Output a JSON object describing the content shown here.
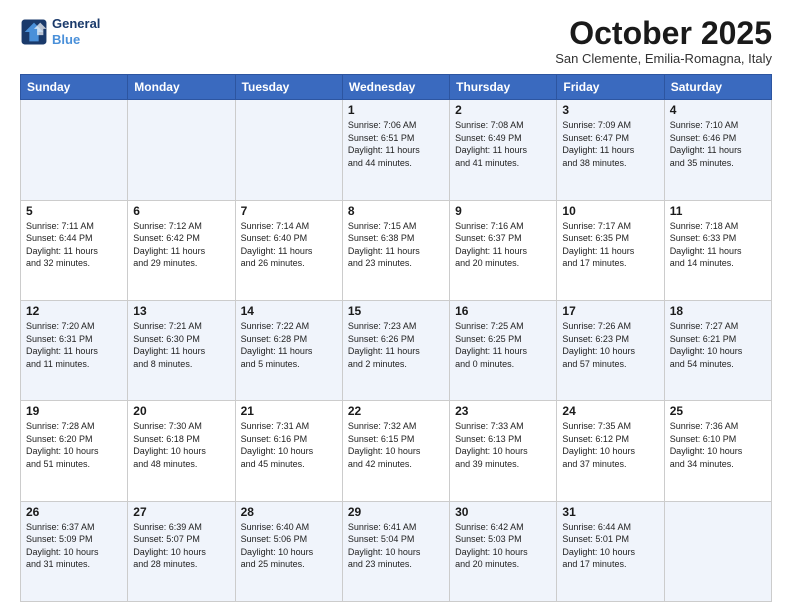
{
  "header": {
    "logo_line1": "General",
    "logo_line2": "Blue",
    "month": "October 2025",
    "location": "San Clemente, Emilia-Romagna, Italy"
  },
  "days_of_week": [
    "Sunday",
    "Monday",
    "Tuesday",
    "Wednesday",
    "Thursday",
    "Friday",
    "Saturday"
  ],
  "weeks": [
    [
      {
        "day": "",
        "info": ""
      },
      {
        "day": "",
        "info": ""
      },
      {
        "day": "",
        "info": ""
      },
      {
        "day": "1",
        "info": "Sunrise: 7:06 AM\nSunset: 6:51 PM\nDaylight: 11 hours\nand 44 minutes."
      },
      {
        "day": "2",
        "info": "Sunrise: 7:08 AM\nSunset: 6:49 PM\nDaylight: 11 hours\nand 41 minutes."
      },
      {
        "day": "3",
        "info": "Sunrise: 7:09 AM\nSunset: 6:47 PM\nDaylight: 11 hours\nand 38 minutes."
      },
      {
        "day": "4",
        "info": "Sunrise: 7:10 AM\nSunset: 6:46 PM\nDaylight: 11 hours\nand 35 minutes."
      }
    ],
    [
      {
        "day": "5",
        "info": "Sunrise: 7:11 AM\nSunset: 6:44 PM\nDaylight: 11 hours\nand 32 minutes."
      },
      {
        "day": "6",
        "info": "Sunrise: 7:12 AM\nSunset: 6:42 PM\nDaylight: 11 hours\nand 29 minutes."
      },
      {
        "day": "7",
        "info": "Sunrise: 7:14 AM\nSunset: 6:40 PM\nDaylight: 11 hours\nand 26 minutes."
      },
      {
        "day": "8",
        "info": "Sunrise: 7:15 AM\nSunset: 6:38 PM\nDaylight: 11 hours\nand 23 minutes."
      },
      {
        "day": "9",
        "info": "Sunrise: 7:16 AM\nSunset: 6:37 PM\nDaylight: 11 hours\nand 20 minutes."
      },
      {
        "day": "10",
        "info": "Sunrise: 7:17 AM\nSunset: 6:35 PM\nDaylight: 11 hours\nand 17 minutes."
      },
      {
        "day": "11",
        "info": "Sunrise: 7:18 AM\nSunset: 6:33 PM\nDaylight: 11 hours\nand 14 minutes."
      }
    ],
    [
      {
        "day": "12",
        "info": "Sunrise: 7:20 AM\nSunset: 6:31 PM\nDaylight: 11 hours\nand 11 minutes."
      },
      {
        "day": "13",
        "info": "Sunrise: 7:21 AM\nSunset: 6:30 PM\nDaylight: 11 hours\nand 8 minutes."
      },
      {
        "day": "14",
        "info": "Sunrise: 7:22 AM\nSunset: 6:28 PM\nDaylight: 11 hours\nand 5 minutes."
      },
      {
        "day": "15",
        "info": "Sunrise: 7:23 AM\nSunset: 6:26 PM\nDaylight: 11 hours\nand 2 minutes."
      },
      {
        "day": "16",
        "info": "Sunrise: 7:25 AM\nSunset: 6:25 PM\nDaylight: 11 hours\nand 0 minutes."
      },
      {
        "day": "17",
        "info": "Sunrise: 7:26 AM\nSunset: 6:23 PM\nDaylight: 10 hours\nand 57 minutes."
      },
      {
        "day": "18",
        "info": "Sunrise: 7:27 AM\nSunset: 6:21 PM\nDaylight: 10 hours\nand 54 minutes."
      }
    ],
    [
      {
        "day": "19",
        "info": "Sunrise: 7:28 AM\nSunset: 6:20 PM\nDaylight: 10 hours\nand 51 minutes."
      },
      {
        "day": "20",
        "info": "Sunrise: 7:30 AM\nSunset: 6:18 PM\nDaylight: 10 hours\nand 48 minutes."
      },
      {
        "day": "21",
        "info": "Sunrise: 7:31 AM\nSunset: 6:16 PM\nDaylight: 10 hours\nand 45 minutes."
      },
      {
        "day": "22",
        "info": "Sunrise: 7:32 AM\nSunset: 6:15 PM\nDaylight: 10 hours\nand 42 minutes."
      },
      {
        "day": "23",
        "info": "Sunrise: 7:33 AM\nSunset: 6:13 PM\nDaylight: 10 hours\nand 39 minutes."
      },
      {
        "day": "24",
        "info": "Sunrise: 7:35 AM\nSunset: 6:12 PM\nDaylight: 10 hours\nand 37 minutes."
      },
      {
        "day": "25",
        "info": "Sunrise: 7:36 AM\nSunset: 6:10 PM\nDaylight: 10 hours\nand 34 minutes."
      }
    ],
    [
      {
        "day": "26",
        "info": "Sunrise: 6:37 AM\nSunset: 5:09 PM\nDaylight: 10 hours\nand 31 minutes."
      },
      {
        "day": "27",
        "info": "Sunrise: 6:39 AM\nSunset: 5:07 PM\nDaylight: 10 hours\nand 28 minutes."
      },
      {
        "day": "28",
        "info": "Sunrise: 6:40 AM\nSunset: 5:06 PM\nDaylight: 10 hours\nand 25 minutes."
      },
      {
        "day": "29",
        "info": "Sunrise: 6:41 AM\nSunset: 5:04 PM\nDaylight: 10 hours\nand 23 minutes."
      },
      {
        "day": "30",
        "info": "Sunrise: 6:42 AM\nSunset: 5:03 PM\nDaylight: 10 hours\nand 20 minutes."
      },
      {
        "day": "31",
        "info": "Sunrise: 6:44 AM\nSunset: 5:01 PM\nDaylight: 10 hours\nand 17 minutes."
      },
      {
        "day": "",
        "info": ""
      }
    ]
  ]
}
